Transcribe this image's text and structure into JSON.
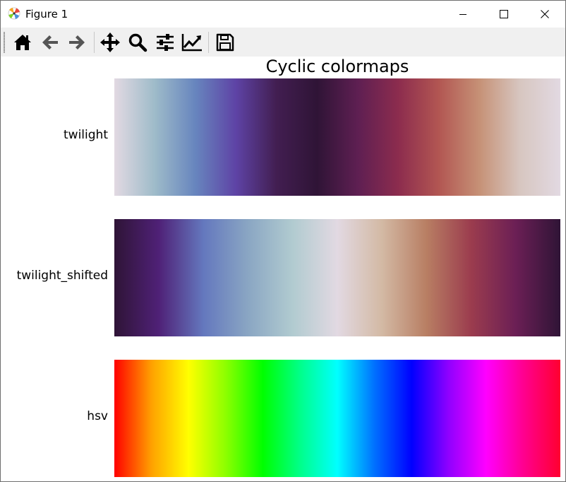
{
  "window": {
    "title": "Figure 1",
    "controls": [
      "minimize",
      "maximize",
      "close"
    ]
  },
  "toolbar": {
    "buttons": [
      {
        "name": "home",
        "icon": "home-icon"
      },
      {
        "name": "back",
        "icon": "arrow-left-icon"
      },
      {
        "name": "forward",
        "icon": "arrow-right-icon"
      },
      {
        "name": "pan",
        "icon": "move-icon"
      },
      {
        "name": "zoom",
        "icon": "magnifier-icon"
      },
      {
        "name": "subplots",
        "icon": "sliders-icon"
      },
      {
        "name": "customize",
        "icon": "chart-line-icon"
      },
      {
        "name": "save",
        "icon": "floppy-disk-icon"
      }
    ]
  },
  "figure": {
    "title": "Cyclic colormaps",
    "colormaps": [
      {
        "name": "twilight",
        "stops": [
          "#e2d9e2",
          "#9ebbc9",
          "#6785be",
          "#5e43a5",
          "#421e51",
          "#2f1436",
          "#5e1f52",
          "#8c2c4e",
          "#b25652",
          "#c69176",
          "#d7c6c0",
          "#e2d9e2"
        ]
      },
      {
        "name": "twilight_shifted",
        "stops": [
          "#2f1436",
          "#4f2177",
          "#6478be",
          "#8aa6c3",
          "#b1cbd0",
          "#e2d9e2",
          "#d3b9a4",
          "#b87e63",
          "#9b3c4e",
          "#6b1f55",
          "#2f1436"
        ]
      },
      {
        "name": "hsv",
        "stops": [
          "#ff0000",
          "#ffa100",
          "#ffff00",
          "#8cff00",
          "#00ff00",
          "#00ff8a",
          "#00ffff",
          "#0070ff",
          "#0000ff",
          "#9100ff",
          "#ff00ff",
          "#ff0090",
          "#ff0030"
        ]
      }
    ]
  }
}
